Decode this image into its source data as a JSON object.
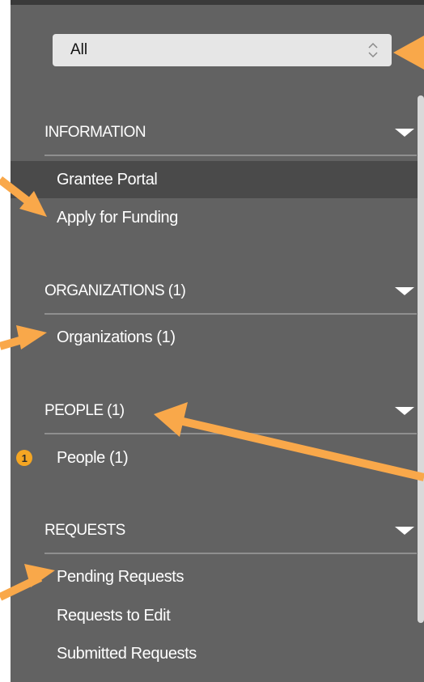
{
  "filter": {
    "selected": "All"
  },
  "sections": [
    {
      "title": "INFORMATION",
      "items": [
        "Grantee Portal",
        "Apply for Funding"
      ]
    },
    {
      "title": "ORGANIZATIONS (1)",
      "items": [
        "Organizations  (1)"
      ]
    },
    {
      "title": "PEOPLE (1)",
      "items": [
        "People  (1)"
      ],
      "badge": "1"
    },
    {
      "title": "REQUESTS",
      "items": [
        "Pending Requests",
        "Requests to Edit",
        "Submitted Requests"
      ]
    }
  ],
  "colors": {
    "panel": "#626262",
    "active_item": "#4a4a4a",
    "annotation_arrow": "#f9a84a",
    "badge": "#f5a623"
  },
  "icons": [
    "chevron-updown-icon",
    "caret-down-icon",
    "annotation-arrow"
  ]
}
